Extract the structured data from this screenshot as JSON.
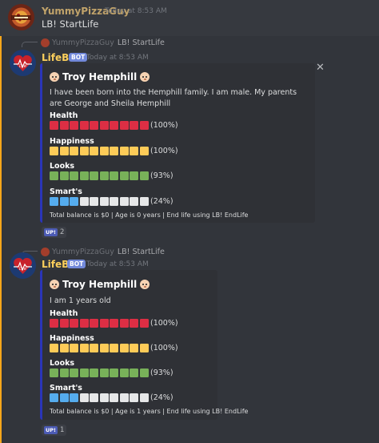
{
  "messages": {
    "first": {
      "username": "YummyPizzaGuy",
      "timestamp": "Today at 8:53 AM",
      "content": "LB! StartLife"
    },
    "second": {
      "reply_user": "YummyPizzaGuy",
      "reply_text": "LB! StartLife",
      "username": "LifeBot",
      "bot_tag": "BOT",
      "timestamp": "Today at 8:53 AM",
      "embed": {
        "title": "Troy Hemphill",
        "description": "I have been born into the Hemphill family. I am male. My parents are George and Sheila Hemphill",
        "stats": {
          "health": {
            "name": "Health",
            "value": "(100%)",
            "filled": 10
          },
          "happiness": {
            "name": "Happiness",
            "value": "(100%)",
            "filled": 10
          },
          "looks": {
            "name": "Looks",
            "value": "(93%)",
            "filled": 10
          },
          "smarts": {
            "name": "Smart's",
            "value": "(24%)",
            "filled": 3
          }
        },
        "footer": "Total balance is $0 | Age is 0 years | End life using LB! EndLife",
        "close_icon": "✕"
      },
      "reaction": {
        "emoji": "UP!",
        "count": "2"
      }
    },
    "third": {
      "reply_user": "YummyPizzaGuy",
      "reply_text": "LB! StartLife",
      "username": "LifeBot",
      "bot_tag": "BOT",
      "timestamp": "Today at 8:53 AM",
      "embed": {
        "title": "Troy Hemphill",
        "description": "I am 1 years old",
        "stats": {
          "health": {
            "name": "Health",
            "value": "(100%)",
            "filled": 10
          },
          "happiness": {
            "name": "Happiness",
            "value": "(100%)",
            "filled": 10
          },
          "looks": {
            "name": "Looks",
            "value": "(93%)",
            "filled": 10
          },
          "smarts": {
            "name": "Smart's",
            "value": "(24%)",
            "filled": 3
          }
        },
        "footer": "Total balance is $0 | Age is 1 years | End life using LB! EndLife"
      },
      "reaction": {
        "emoji": "UP!",
        "count": "1"
      }
    }
  },
  "colors": {
    "background": "#36393f",
    "embed_background": "#2f3136",
    "embed_accent": "#2a35b8",
    "highlight_border": "#faa61a",
    "bot_tag": "#7289da",
    "bar_health": "#dd2e44",
    "bar_happiness": "#fdcb58",
    "bar_looks": "#78b159",
    "bar_smarts": "#55acee",
    "bar_empty": "#e6e7e8"
  },
  "icons": {
    "baby": "baby-face-icon",
    "close": "close-icon",
    "reply": "reply-curve-icon"
  }
}
